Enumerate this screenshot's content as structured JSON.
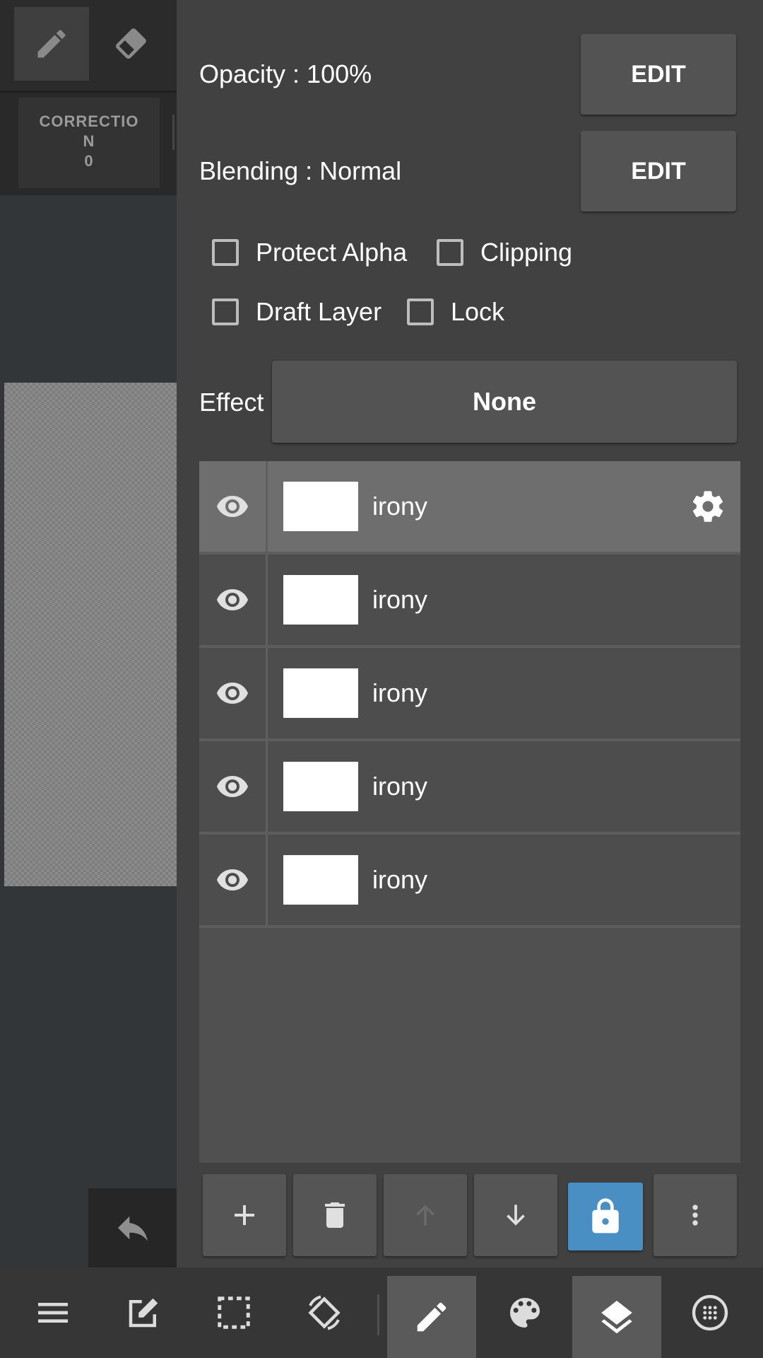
{
  "left_toolbar": {
    "correction_lines": [
      "CORRECTIO",
      "N",
      "0"
    ]
  },
  "layer_properties": {
    "opacity_label": "Opacity : 100%",
    "opacity_edit": "EDIT",
    "blending_label": "Blending : Normal",
    "blending_edit": "EDIT",
    "checkboxes": [
      {
        "label": "Protect Alpha",
        "checked": false
      },
      {
        "label": "Clipping",
        "checked": false
      },
      {
        "label": "Draft Layer",
        "checked": false
      },
      {
        "label": "Lock",
        "checked": false
      }
    ],
    "effect_label": "Effect",
    "effect_value": "None"
  },
  "layers": [
    {
      "name": "irony",
      "selected": true
    },
    {
      "name": "irony",
      "selected": false
    },
    {
      "name": "irony",
      "selected": false
    },
    {
      "name": "irony",
      "selected": false
    },
    {
      "name": "irony",
      "selected": false
    }
  ],
  "layer_actions": [
    "add-icon",
    "trash-icon",
    "arrow-up-icon",
    "arrow-down-icon",
    "lock-icon",
    "more-vertical-icon"
  ],
  "nav_bar": [
    "menu-icon",
    "edit-icon",
    "selection-icon",
    "rotate-icon",
    "pen-icon",
    "palette-icon",
    "layers-icon",
    "material-icon"
  ],
  "colors": {
    "lock_active": "#4a8fc4",
    "panel": "#414141"
  }
}
